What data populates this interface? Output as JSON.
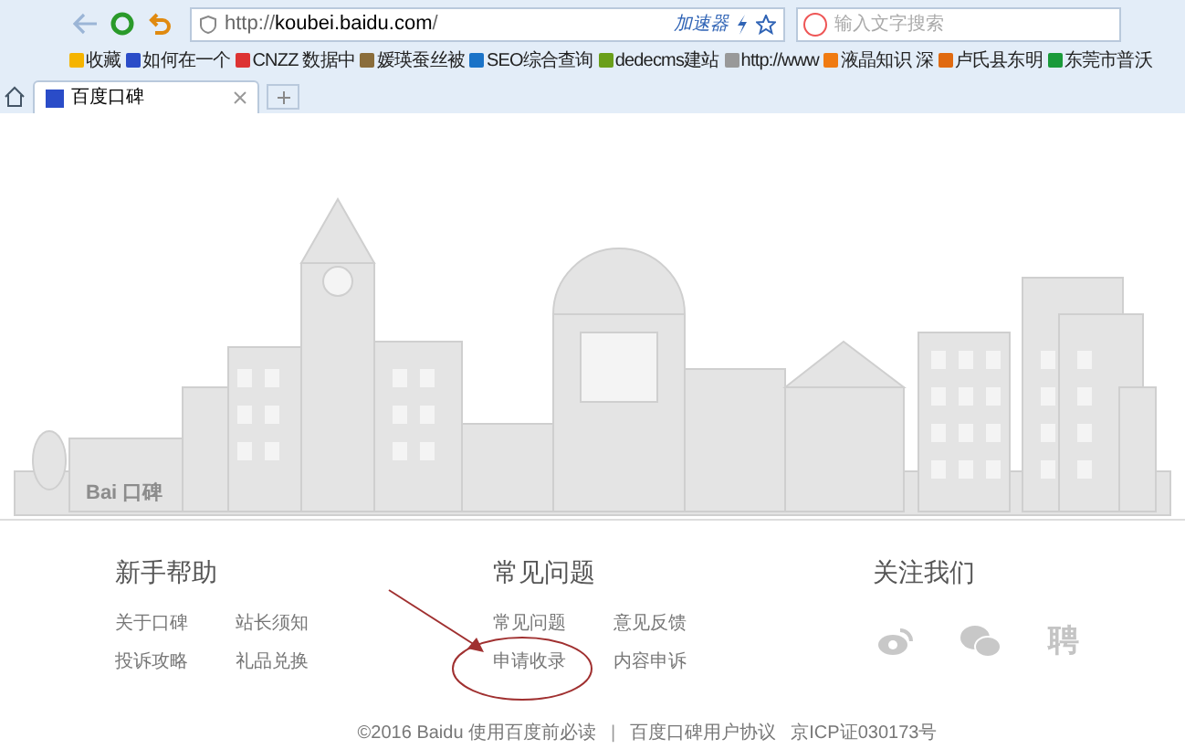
{
  "toolbar": {
    "url_prefix": "http://",
    "url_host": "koubei.baidu.com",
    "url_suffix": "/",
    "accelerator": "加速器",
    "search_placeholder": "输入文字搜索"
  },
  "bookmarks": [
    "收藏",
    "如何在一个",
    "CNZZ 数据中",
    "媛瑛蚕丝被",
    "SEO综合查询",
    "dedecms建站",
    "http://www",
    "液晶知识 深",
    "卢氏县东明",
    "东莞市普沃"
  ],
  "tabs": [
    {
      "label": "百度口碑",
      "selected": true
    }
  ],
  "illustration": {
    "sign_left": "Bai",
    "sign_right": "口碑"
  },
  "footer": {
    "columns": [
      {
        "title": "新手帮助",
        "links": [
          "关于口碑",
          "站长须知",
          "投诉攻略",
          "礼品兑换"
        ]
      },
      {
        "title": "常见问题",
        "links": [
          "常见问题",
          "意见反馈",
          "申请收录",
          "内容申诉"
        ]
      },
      {
        "title": "关注我们",
        "social": [
          {
            "kind": "weibo"
          },
          {
            "kind": "wechat"
          },
          {
            "kind": "text",
            "text": "聘"
          }
        ]
      }
    ],
    "copyright": "©2016 Baidu 使用百度前必读",
    "separator": "|",
    "agreement": "百度口碑用户协议",
    "icp": "京ICP证030173号"
  }
}
